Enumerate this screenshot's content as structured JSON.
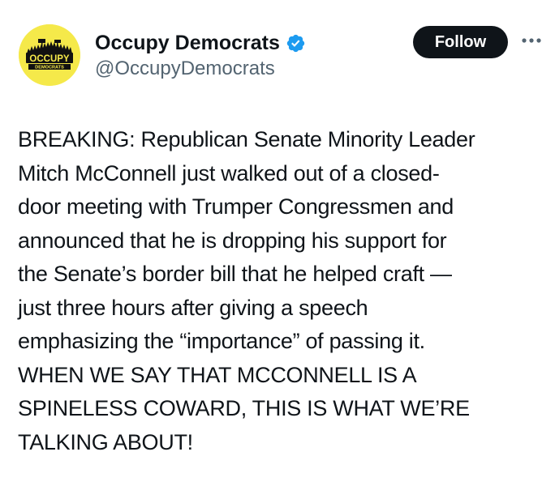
{
  "author": {
    "display_name": "Occupy Democrats",
    "handle": "@OccupyDemocrats",
    "verified": true,
    "avatar_text_top": "OCCUPY",
    "avatar_text_bottom": "DEMOCRATS",
    "avatar_bg_color": "#f5e94a",
    "verified_color": "#1d9bf0"
  },
  "actions": {
    "follow_label": "Follow",
    "more_icon": "more-horizontal-icon"
  },
  "tweet": {
    "lines": [
      "BREAKING: Republican Senate Minority Leader",
      "Mitch McConnell just walked out of a closed-",
      "door meeting with Trumper Congressmen and",
      "announced that he is dropping his support for",
      "the Senate’s border bill that he helped craft —",
      "just three hours after giving a speech",
      "emphasizing the “importance” of passing it.",
      "WHEN WE SAY THAT MCCONNELL IS A",
      "SPINELESS COWARD, THIS IS WHAT WE’RE",
      "TALKING ABOUT!"
    ]
  }
}
